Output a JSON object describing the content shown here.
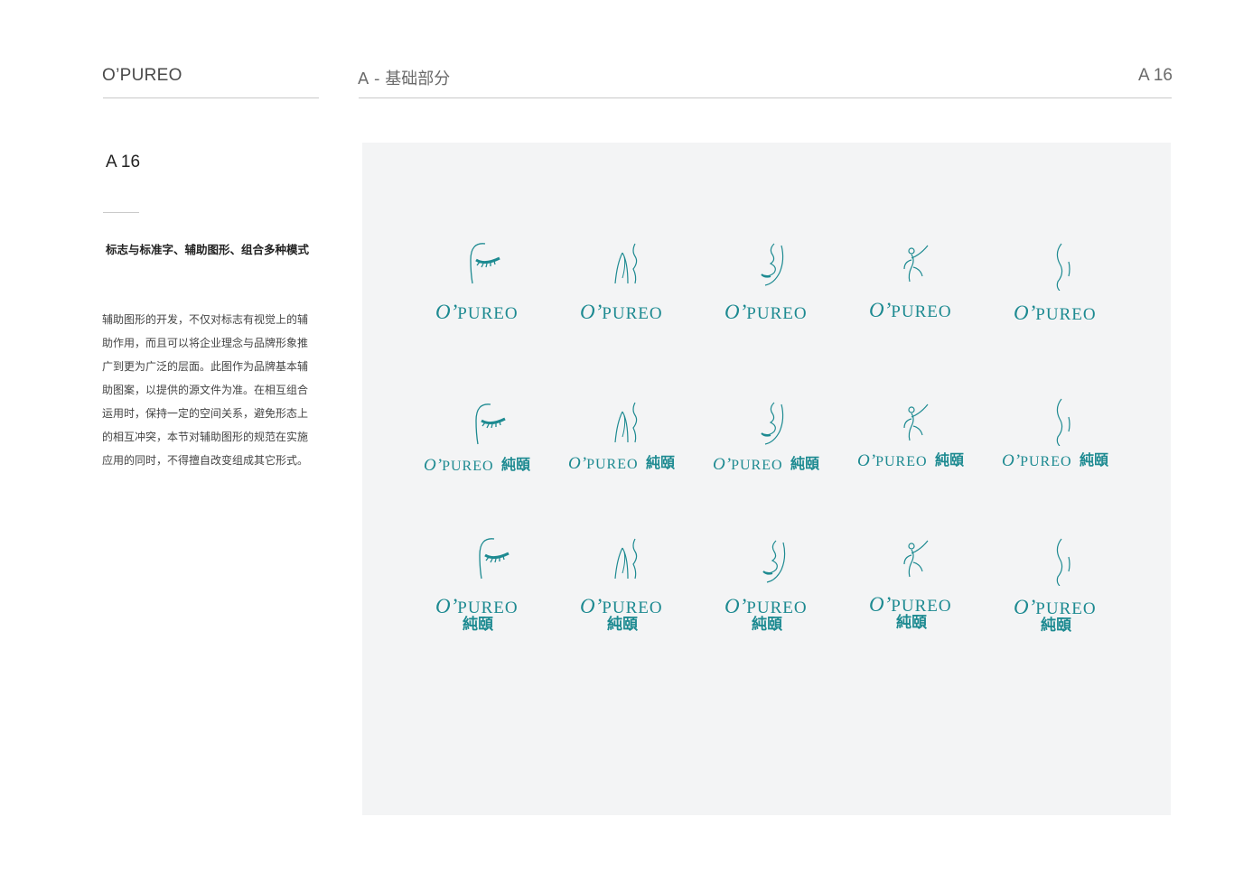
{
  "header": {
    "brand": "O’PUREO",
    "section": "A - 基础部分",
    "page_number": "A 16"
  },
  "sidebar": {
    "code": "A 16",
    "subtitle": "标志与标准字、辅助图形、组合多种模式",
    "body_lines": [
      "辅助图形的开发，不仅对标志有视觉上的辅",
      "助作用，而且可以将企业理念与品牌形象推",
      "广到更为广泛的层面。此图作为品牌基本辅",
      "助图案，以提供的源文件为准。在相互组合",
      "运用时，保持一定的空间关系，避免形态上",
      "的相互冲突，本节对辅助图形的规范在实施",
      "应用的同时，不得擅自改变组成其它形式。"
    ]
  },
  "logo_grid": {
    "brand_color": "#1d8a91",
    "wordmark_o": "O’",
    "wordmark_rest": "PUREO",
    "chinese_name": "純頤",
    "icons": [
      "eyelash-icon",
      "neck-shoulder-icon",
      "face-profile-icon",
      "figure-icon",
      "body-curve-icon"
    ],
    "rows": [
      "stacked",
      "horizontal-with-chinese",
      "stacked-with-chinese"
    ]
  }
}
